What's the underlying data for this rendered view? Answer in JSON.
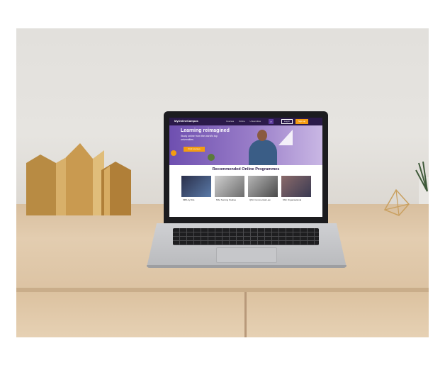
{
  "website": {
    "logo": "MyOnlineCampus",
    "nav_links": [
      "Courses",
      "Online",
      "Universities"
    ],
    "search_icon": "search-icon",
    "login_label": "Log in",
    "signup_label": "Sign up",
    "hero": {
      "title": "Learning reimagined",
      "subtitle": "Study online from the world's top universities",
      "cta_label": "Find courses"
    },
    "section_title": "Recommended Online Programmes",
    "programmes": [
      {
        "label": "MBA by Dist."
      },
      {
        "label": "MSc Nursing Studies"
      },
      {
        "label": "QSC Commercial Law"
      },
      {
        "label": "MSc Organisational"
      }
    ]
  },
  "colors": {
    "brand_purple": "#2b1a4a",
    "accent_orange": "#f39c12",
    "hero_gradient_start": "#6e4fb0"
  }
}
